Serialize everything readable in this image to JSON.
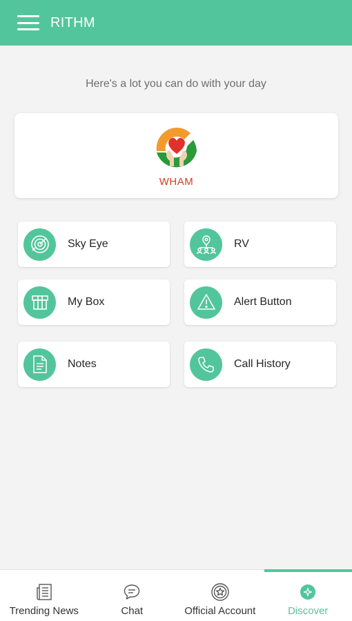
{
  "app": {
    "title": "RITHM"
  },
  "tagline": "Here's a lot you can do with your day",
  "feature_card": {
    "label": "WHAM",
    "label_color": "#d33d1e"
  },
  "tiles": [
    {
      "label": "Sky Eye",
      "icon": "radar-icon"
    },
    {
      "label": "RV",
      "icon": "network-location-icon"
    },
    {
      "label": "My Box",
      "icon": "box-icon"
    },
    {
      "label": "Alert Button",
      "icon": "warning-icon"
    },
    {
      "label": "Notes",
      "icon": "document-icon"
    },
    {
      "label": "Call History",
      "icon": "phone-icon"
    }
  ],
  "bottom_nav": [
    {
      "label": "Trending News",
      "icon": "newspaper-icon",
      "active": false
    },
    {
      "label": "Chat",
      "icon": "chat-bubble-icon",
      "active": false
    },
    {
      "label": "Official Account",
      "icon": "star-badge-icon",
      "active": false
    },
    {
      "label": "Discover",
      "icon": "compass-icon",
      "active": true
    }
  ],
  "colors": {
    "accent": "#53c59c",
    "background": "#f3f3f3",
    "brand_red": "#d33d1e"
  }
}
